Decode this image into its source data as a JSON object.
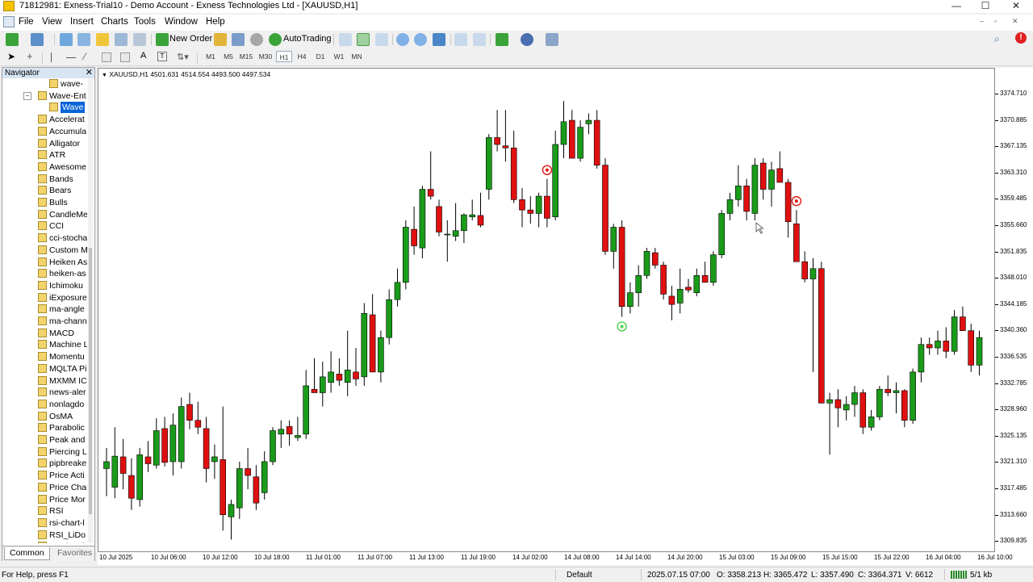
{
  "window": {
    "title": "71812981: Exness-Trial10 - Demo Account - Exness Technologies Ltd - [XAUUSD,H1]",
    "controls": [
      "—",
      "☐",
      "✕"
    ]
  },
  "menu": [
    "File",
    "View",
    "Insert",
    "Charts",
    "Tools",
    "Window",
    "Help"
  ],
  "toolbar": {
    "new_order": "New Order",
    "autotrading": "AutoTrading",
    "timeframes": [
      "M1",
      "M5",
      "M15",
      "M30",
      "H1",
      "H4",
      "D1",
      "W1",
      "MN"
    ],
    "active_timeframe": "H1"
  },
  "navigator": {
    "title": "Navigator",
    "items": [
      {
        "label": "wave-",
        "level": 3
      },
      {
        "label": "Wave-Ent",
        "level": 2
      },
      {
        "label": "Wave",
        "level": 3,
        "selected": true
      },
      {
        "label": "Accelerat",
        "level": 2
      },
      {
        "label": "Accumula",
        "level": 2
      },
      {
        "label": "Alligator",
        "level": 2
      },
      {
        "label": "ATR",
        "level": 2
      },
      {
        "label": "Awesome",
        "level": 2
      },
      {
        "label": "Bands",
        "level": 2
      },
      {
        "label": "Bears",
        "level": 2
      },
      {
        "label": "Bulls",
        "level": 2
      },
      {
        "label": "CandleMe",
        "level": 2
      },
      {
        "label": "CCI",
        "level": 2
      },
      {
        "label": "cci-stocha",
        "level": 2
      },
      {
        "label": "Custom M",
        "level": 2
      },
      {
        "label": "Heiken As",
        "level": 2
      },
      {
        "label": "heiken-as",
        "level": 2
      },
      {
        "label": "Ichimoku",
        "level": 2
      },
      {
        "label": "iExposure",
        "level": 2
      },
      {
        "label": "ma-angle",
        "level": 2
      },
      {
        "label": "ma-chann",
        "level": 2
      },
      {
        "label": "MACD",
        "level": 2
      },
      {
        "label": "Machine L",
        "level": 2
      },
      {
        "label": "Momentu",
        "level": 2
      },
      {
        "label": "MQLTA Pi",
        "level": 2
      },
      {
        "label": "MXMM IC",
        "level": 2
      },
      {
        "label": "news-aler",
        "level": 2
      },
      {
        "label": "nonlagdo",
        "level": 2
      },
      {
        "label": "OsMA",
        "level": 2
      },
      {
        "label": "Parabolic",
        "level": 2
      },
      {
        "label": "Peak and",
        "level": 2
      },
      {
        "label": "Piercing L",
        "level": 2
      },
      {
        "label": "pipbreake",
        "level": 2
      },
      {
        "label": "Price Acti",
        "level": 2
      },
      {
        "label": "Price Char",
        "level": 2
      },
      {
        "label": "Price Mor",
        "level": 2
      },
      {
        "label": "RSI",
        "level": 2
      },
      {
        "label": "rsi-chart-l",
        "level": 2
      },
      {
        "label": "RSI_LiDo",
        "level": 2
      },
      {
        "label": "Stochasti",
        "level": 2
      }
    ],
    "tabs": [
      "Common",
      "Favorites"
    ]
  },
  "chart": {
    "symbol_line": "XAUUSD,H1  4501.631 4514.554 4493.500 4497.534",
    "price_labels": [
      "3374.710",
      "3370.885",
      "3367.135",
      "3363.310",
      "3359.485",
      "3355.660",
      "3351.835",
      "3348.010",
      "3344.185",
      "3340.360",
      "3336.535",
      "3332.785",
      "3328.960",
      "3325.135",
      "3321.310",
      "3317.485",
      "3313.660",
      "3309.835"
    ],
    "time_labels": [
      "10 Jul 2025",
      "10 Jul 06:00",
      "10 Jul 12:00",
      "10 Jul 18:00",
      "11 Jul 01:00",
      "11 Jul 07:00",
      "11 Jul 13:00",
      "11 Jul 19:00",
      "14 Jul 02:00",
      "14 Jul 08:00",
      "14 Jul 14:00",
      "14 Jul 20:00",
      "15 Jul 03:00",
      "15 Jul 09:00",
      "15 Jul 15:00",
      "15 Jul 22:00",
      "16 Jul 04:00",
      "16 Jul 10:00"
    ]
  },
  "colors": {
    "bull": "#1a9b1a",
    "bear": "#e01010",
    "peak_marker": "#e01818",
    "trough_marker": "#4cd04c"
  },
  "chart_data": {
    "type": "candlestick",
    "symbol": "XAUUSD",
    "timeframe": "H1",
    "ylim": [
      3307.5,
      3377.5
    ],
    "candles": [
      {
        "o": 3319.5,
        "h": 3322.5,
        "l": 3315.5,
        "c": 3320.5
      },
      {
        "o": 3316.8,
        "h": 3325.5,
        "l": 3315.2,
        "c": 3321.3
      },
      {
        "o": 3321.2,
        "h": 3323.8,
        "l": 3316.5,
        "c": 3318.8
      },
      {
        "o": 3318.5,
        "h": 3321.0,
        "l": 3313.5,
        "c": 3315.2
      },
      {
        "o": 3315.0,
        "h": 3322.5,
        "l": 3314.0,
        "c": 3321.5
      },
      {
        "o": 3321.2,
        "h": 3323.5,
        "l": 3319.0,
        "c": 3320.2
      },
      {
        "o": 3320.0,
        "h": 3326.8,
        "l": 3319.5,
        "c": 3325.0
      },
      {
        "o": 3325.3,
        "h": 3327.0,
        "l": 3319.8,
        "c": 3320.4
      },
      {
        "o": 3320.5,
        "h": 3327.5,
        "l": 3318.5,
        "c": 3325.8
      },
      {
        "o": 3320.5,
        "h": 3329.8,
        "l": 3319.5,
        "c": 3328.5
      },
      {
        "o": 3328.8,
        "h": 3330.5,
        "l": 3325.2,
        "c": 3326.5
      },
      {
        "o": 3326.5,
        "h": 3329.2,
        "l": 3324.5,
        "c": 3325.5
      },
      {
        "o": 3325.3,
        "h": 3327.0,
        "l": 3317.5,
        "c": 3319.5
      },
      {
        "o": 3320.5,
        "h": 3323.0,
        "l": 3318.0,
        "c": 3321.2
      },
      {
        "o": 3320.8,
        "h": 3328.5,
        "l": 3310.5,
        "c": 3312.8
      },
      {
        "o": 3312.5,
        "h": 3315.0,
        "l": 3309.2,
        "c": 3314.3
      },
      {
        "o": 3313.8,
        "h": 3320.5,
        "l": 3312.2,
        "c": 3319.5
      },
      {
        "o": 3319.5,
        "h": 3322.5,
        "l": 3316.5,
        "c": 3318.5
      },
      {
        "o": 3318.3,
        "h": 3320.0,
        "l": 3313.5,
        "c": 3314.5
      },
      {
        "o": 3316.0,
        "h": 3322.0,
        "l": 3315.0,
        "c": 3320.5
      },
      {
        "o": 3320.5,
        "h": 3325.5,
        "l": 3320.0,
        "c": 3325.0
      },
      {
        "o": 3324.5,
        "h": 3326.5,
        "l": 3322.5,
        "c": 3325.2
      },
      {
        "o": 3325.6,
        "h": 3326.5,
        "l": 3322.8,
        "c": 3324.5
      },
      {
        "o": 3324.0,
        "h": 3327.0,
        "l": 3323.5,
        "c": 3324.3
      },
      {
        "o": 3324.5,
        "h": 3333.8,
        "l": 3323.8,
        "c": 3331.5
      },
      {
        "o": 3331.0,
        "h": 3335.5,
        "l": 3330.5,
        "c": 3330.5
      },
      {
        "o": 3330.5,
        "h": 3335.0,
        "l": 3328.5,
        "c": 3332.8
      },
      {
        "o": 3332.0,
        "h": 3336.5,
        "l": 3330.5,
        "c": 3333.5
      },
      {
        "o": 3333.2,
        "h": 3335.5,
        "l": 3331.5,
        "c": 3332.3
      },
      {
        "o": 3332.0,
        "h": 3339.5,
        "l": 3330.0,
        "c": 3333.8
      },
      {
        "o": 3333.5,
        "h": 3337.0,
        "l": 3331.5,
        "c": 3332.5
      },
      {
        "o": 3332.8,
        "h": 3343.5,
        "l": 3331.5,
        "c": 3342.0
      },
      {
        "o": 3341.8,
        "h": 3344.8,
        "l": 3340.0,
        "c": 3333.5
      },
      {
        "o": 3333.5,
        "h": 3339.5,
        "l": 3332.0,
        "c": 3338.5
      },
      {
        "o": 3338.5,
        "h": 3345.5,
        "l": 3337.5,
        "c": 3344.0
      },
      {
        "o": 3344.0,
        "h": 3348.5,
        "l": 3343.0,
        "c": 3346.5
      },
      {
        "o": 3346.5,
        "h": 3355.5,
        "l": 3345.5,
        "c": 3354.5
      },
      {
        "o": 3354.2,
        "h": 3357.5,
        "l": 3350.5,
        "c": 3351.8
      },
      {
        "o": 3351.5,
        "h": 3360.5,
        "l": 3350.0,
        "c": 3360.0
      },
      {
        "o": 3360.0,
        "h": 3365.5,
        "l": 3358.5,
        "c": 3359.0
      },
      {
        "o": 3357.5,
        "h": 3358.5,
        "l": 3353.2,
        "c": 3353.8
      },
      {
        "o": 3353.5,
        "h": 3355.5,
        "l": 3349.5,
        "c": 3353.5
      },
      {
        "o": 3353.2,
        "h": 3358.0,
        "l": 3352.5,
        "c": 3354.0
      },
      {
        "o": 3354.0,
        "h": 3356.5,
        "l": 3352.2,
        "c": 3356.3
      },
      {
        "o": 3356.0,
        "h": 3358.5,
        "l": 3355.5,
        "c": 3356.3
      },
      {
        "o": 3356.2,
        "h": 3359.5,
        "l": 3354.5,
        "c": 3354.8
      },
      {
        "o": 3360.0,
        "h": 3368.0,
        "l": 3358.5,
        "c": 3367.5
      },
      {
        "o": 3367.5,
        "h": 3371.5,
        "l": 3365.5,
        "c": 3366.5
      },
      {
        "o": 3366.3,
        "h": 3371.5,
        "l": 3364.0,
        "c": 3366.0
      },
      {
        "o": 3366.0,
        "h": 3368.5,
        "l": 3358.0,
        "c": 3358.5
      },
      {
        "o": 3358.5,
        "h": 3360.2,
        "l": 3354.5,
        "c": 3357.0
      },
      {
        "o": 3357.0,
        "h": 3359.0,
        "l": 3355.0,
        "c": 3356.5
      },
      {
        "o": 3356.5,
        "h": 3359.5,
        "l": 3354.5,
        "c": 3359.0
      },
      {
        "o": 3359.0,
        "h": 3361.5,
        "l": 3354.5,
        "c": 3355.8
      },
      {
        "o": 3356.0,
        "h": 3368.5,
        "l": 3355.5,
        "c": 3366.5
      },
      {
        "o": 3366.5,
        "h": 3372.8,
        "l": 3364.5,
        "c": 3369.8
      },
      {
        "o": 3370.0,
        "h": 3371.5,
        "l": 3364.5,
        "c": 3364.5
      },
      {
        "o": 3364.5,
        "h": 3370.0,
        "l": 3364.0,
        "c": 3369.0
      },
      {
        "o": 3369.5,
        "h": 3371.0,
        "l": 3368.0,
        "c": 3370.0
      },
      {
        "o": 3370.0,
        "h": 3371.5,
        "l": 3363.0,
        "c": 3363.5
      },
      {
        "o": 3363.5,
        "h": 3364.5,
        "l": 3350.5,
        "c": 3351.0
      },
      {
        "o": 3351.0,
        "h": 3355.0,
        "l": 3348.5,
        "c": 3354.5
      },
      {
        "o": 3354.5,
        "h": 3355.5,
        "l": 3341.5,
        "c": 3343.0
      },
      {
        "o": 3343.0,
        "h": 3346.5,
        "l": 3342.0,
        "c": 3345.0
      },
      {
        "o": 3345.0,
        "h": 3349.0,
        "l": 3343.0,
        "c": 3347.5
      },
      {
        "o": 3347.5,
        "h": 3351.5,
        "l": 3347.0,
        "c": 3351.0
      },
      {
        "o": 3350.8,
        "h": 3351.5,
        "l": 3348.5,
        "c": 3349.0
      },
      {
        "o": 3349.0,
        "h": 3349.5,
        "l": 3344.0,
        "c": 3344.8
      },
      {
        "o": 3344.5,
        "h": 3346.0,
        "l": 3341.0,
        "c": 3343.3
      },
      {
        "o": 3343.5,
        "h": 3348.5,
        "l": 3342.0,
        "c": 3345.5
      },
      {
        "o": 3345.8,
        "h": 3347.0,
        "l": 3345.0,
        "c": 3345.4
      },
      {
        "o": 3345.0,
        "h": 3348.5,
        "l": 3344.5,
        "c": 3347.5
      },
      {
        "o": 3347.5,
        "h": 3349.5,
        "l": 3346.5,
        "c": 3346.5
      },
      {
        "o": 3346.5,
        "h": 3351.0,
        "l": 3346.0,
        "c": 3350.5
      },
      {
        "o": 3350.5,
        "h": 3357.0,
        "l": 3350.0,
        "c": 3356.5
      },
      {
        "o": 3356.5,
        "h": 3359.5,
        "l": 3355.5,
        "c": 3358.5
      },
      {
        "o": 3358.5,
        "h": 3363.5,
        "l": 3357.5,
        "c": 3360.5
      },
      {
        "o": 3360.5,
        "h": 3361.5,
        "l": 3355.5,
        "c": 3356.8
      },
      {
        "o": 3356.5,
        "h": 3364.5,
        "l": 3355.5,
        "c": 3363.5
      },
      {
        "o": 3363.8,
        "h": 3364.5,
        "l": 3358.5,
        "c": 3360.0
      },
      {
        "o": 3360.0,
        "h": 3364.0,
        "l": 3357.5,
        "c": 3362.8
      },
      {
        "o": 3363.0,
        "h": 3365.5,
        "l": 3361.5,
        "c": 3361.0
      },
      {
        "o": 3361.0,
        "h": 3361.5,
        "l": 3353.0,
        "c": 3355.3
      },
      {
        "o": 3355.0,
        "h": 3357.0,
        "l": 3349.5,
        "c": 3349.5
      },
      {
        "o": 3349.5,
        "h": 3351.0,
        "l": 3346.5,
        "c": 3347.0
      },
      {
        "o": 3347.0,
        "h": 3350.0,
        "l": 3333.5,
        "c": 3348.5
      },
      {
        "o": 3348.5,
        "h": 3349.5,
        "l": 3329.0,
        "c": 3329.0
      },
      {
        "o": 3329.0,
        "h": 3330.5,
        "l": 3321.5,
        "c": 3329.5
      },
      {
        "o": 3329.5,
        "h": 3331.0,
        "l": 3325.5,
        "c": 3328.3
      },
      {
        "o": 3328.0,
        "h": 3330.0,
        "l": 3326.5,
        "c": 3328.8
      },
      {
        "o": 3328.8,
        "h": 3331.5,
        "l": 3327.0,
        "c": 3330.5
      },
      {
        "o": 3330.5,
        "h": 3331.0,
        "l": 3324.5,
        "c": 3325.5
      },
      {
        "o": 3325.5,
        "h": 3328.0,
        "l": 3325.0,
        "c": 3327.0
      },
      {
        "o": 3327.0,
        "h": 3331.5,
        "l": 3326.5,
        "c": 3331.0
      },
      {
        "o": 3331.0,
        "h": 3333.0,
        "l": 3330.0,
        "c": 3330.5
      },
      {
        "o": 3330.5,
        "h": 3332.0,
        "l": 3327.5,
        "c": 3330.8
      },
      {
        "o": 3330.8,
        "h": 3331.0,
        "l": 3325.5,
        "c": 3326.5
      },
      {
        "o": 3326.5,
        "h": 3334.0,
        "l": 3326.0,
        "c": 3333.5
      },
      {
        "o": 3333.5,
        "h": 3338.5,
        "l": 3332.0,
        "c": 3337.5
      },
      {
        "o": 3337.5,
        "h": 3338.5,
        "l": 3336.0,
        "c": 3337.0
      },
      {
        "o": 3337.0,
        "h": 3339.5,
        "l": 3336.0,
        "c": 3338.0
      },
      {
        "o": 3338.0,
        "h": 3340.0,
        "l": 3335.5,
        "c": 3336.5
      },
      {
        "o": 3336.5,
        "h": 3342.5,
        "l": 3336.0,
        "c": 3341.5
      },
      {
        "o": 3341.5,
        "h": 3343.0,
        "l": 3339.5,
        "c": 3339.5
      },
      {
        "o": 3339.5,
        "h": 3340.5,
        "l": 3333.5,
        "c": 3334.5
      },
      {
        "o": 3334.5,
        "h": 3339.5,
        "l": 3333.0,
        "c": 3338.5
      }
    ],
    "markers": [
      {
        "type": "peak",
        "index": 53
      },
      {
        "type": "trough",
        "index": 62
      },
      {
        "type": "peak",
        "index": 83
      }
    ]
  },
  "status": {
    "help": "For Help, press F1",
    "profile": "Default",
    "datetime": "2025.07.15 07:00",
    "open": "O: 3358.213",
    "high": "H: 3365.472",
    "low": "L: 3357.490",
    "close": "C: 3364.371",
    "volume": "V: 6612",
    "traffic": "5/1 kb"
  }
}
